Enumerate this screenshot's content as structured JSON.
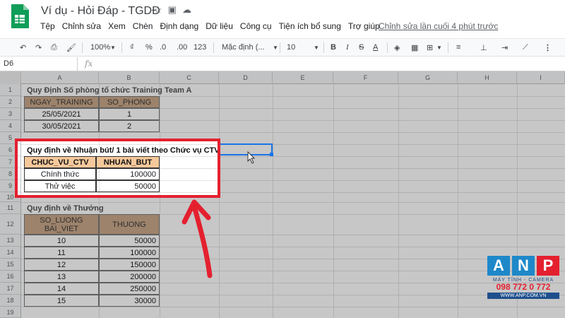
{
  "app": {
    "title": "Ví dụ - Hỏi Đáp - TGDĐ",
    "star_icon": "star-icon",
    "folder_icon": "folder-move-icon",
    "cloud_icon": "cloud-status-icon",
    "menu": [
      "Tệp",
      "Chỉnh sửa",
      "Xem",
      "Chèn",
      "Định dạng",
      "Dữ liệu",
      "Công cụ",
      "Tiện ích bổ sung",
      "Trợ giúp"
    ],
    "last_edit": "Chỉnh sửa lần cuối 4 phút trước"
  },
  "toolbar": {
    "zoom": "100%",
    "currency": "₫",
    "percent": "%",
    "dec_less": ".0",
    "dec_more": ".00",
    "more_formats": "123",
    "font": "Mặc định (...",
    "font_size": "10",
    "bold": "B",
    "italic": "I",
    "strike": "S",
    "text_color": "A"
  },
  "formula": {
    "cell_ref": "D6",
    "fx": "fx"
  },
  "columns": [
    "A",
    "B",
    "C",
    "D",
    "E",
    "F",
    "G",
    "H",
    "I"
  ],
  "rows": [
    "1",
    "2",
    "3",
    "4",
    "5",
    "6",
    "7",
    "8",
    "9",
    "10",
    "11",
    "12",
    "13",
    "14",
    "15",
    "16",
    "17",
    "18",
    "19"
  ],
  "table1": {
    "title": "Quy Định Số phòng tổ chức Training Team A",
    "headers": [
      "NGAY_TRAINING",
      "SO_PHONG"
    ],
    "rows": [
      [
        "25/05/2021",
        "1"
      ],
      [
        "30/05/2021",
        "2"
      ]
    ]
  },
  "table2": {
    "title": "Quy định về Nhuận bút/ 1 bài viết theo Chức vụ CTV",
    "headers": [
      "CHUC_VU_CTV",
      "NHUAN_BUT"
    ],
    "rows": [
      [
        "Chính thức",
        "100000"
      ],
      [
        "Thử việc",
        "50000"
      ]
    ]
  },
  "table3": {
    "title": "Quy định về Thưởng",
    "headers": [
      "SO_LUONG\nBAI_VIET",
      "THUONG"
    ],
    "rows": [
      [
        "10",
        "50000"
      ],
      [
        "11",
        "100000"
      ],
      [
        "12",
        "150000"
      ],
      [
        "13",
        "200000"
      ],
      [
        "14",
        "250000"
      ],
      [
        "15",
        "30000"
      ]
    ]
  },
  "watermark": {
    "letters": [
      "A",
      "N",
      "P"
    ],
    "subtitle": "MÁY TÍNH - CAMERA",
    "phone": "098 772 0 772",
    "website": "WWW.ANP.COM.VN"
  },
  "colors": {
    "highlight": "#e4202f",
    "header_fill": "#c9a88a",
    "header_fill_active": "#f5c89b",
    "selection": "#1a73e8"
  }
}
